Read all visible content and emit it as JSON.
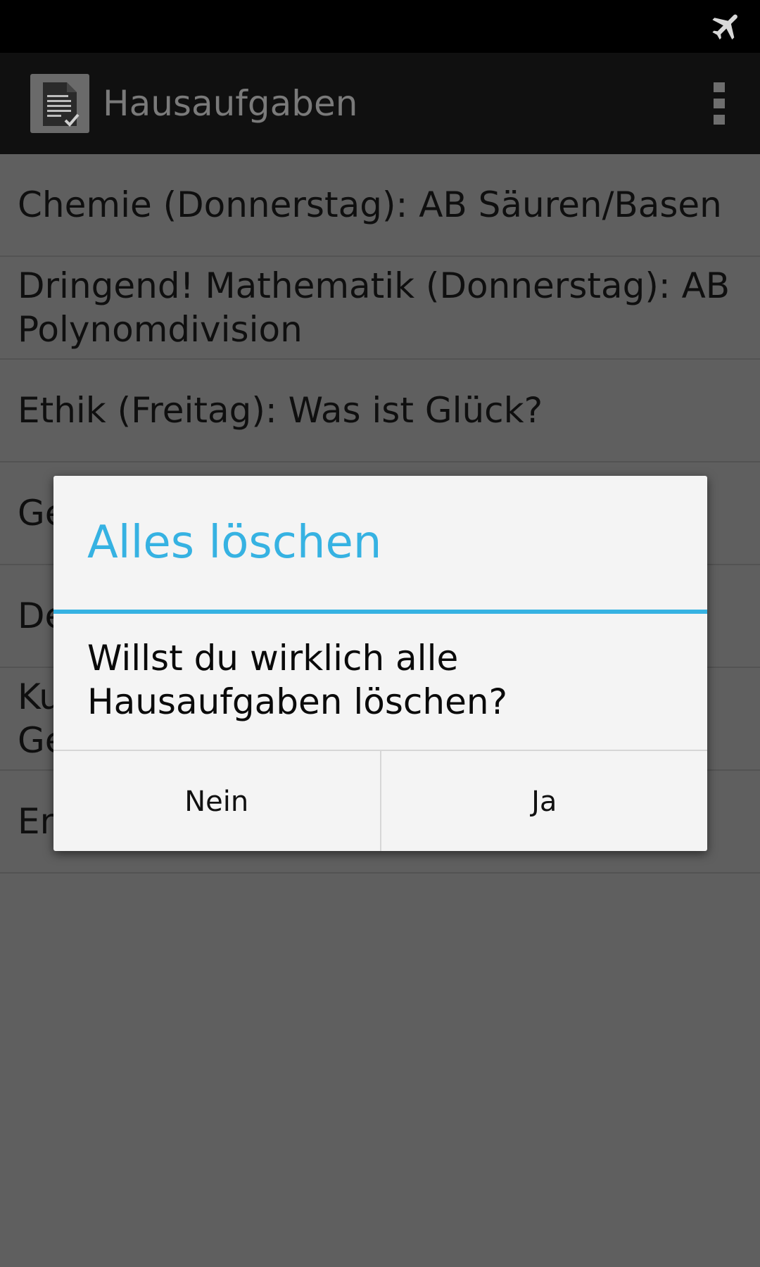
{
  "status_bar": {
    "icons": [
      "airplane-mode-icon"
    ]
  },
  "action_bar": {
    "app_icon": "homework-document-icon",
    "title": "Hausaufgaben",
    "overflow_icon": "overflow-menu-icon"
  },
  "homework_list": {
    "items": [
      {
        "lines": [
          "Chemie (Donnerstag): AB Säuren/Basen"
        ]
      },
      {
        "lines": [
          "Dringend! Mathematik (Donnerstag): AB",
          "Polynomdivision"
        ]
      },
      {
        "lines": [
          "Ethik (Freitag): Was ist Glück?"
        ]
      },
      {
        "lines": [
          "Ge"
        ]
      },
      {
        "lines": [
          "De"
        ]
      },
      {
        "lines": [
          "Ku",
          "Ge"
        ]
      },
      {
        "lines": [
          "En"
        ]
      }
    ]
  },
  "dialog": {
    "title": "Alles löschen",
    "message_lines": [
      "Willst du wirklich alle",
      "Hausaufgaben löschen?"
    ],
    "negative_label": "Nein",
    "positive_label": "Ja"
  },
  "colors": {
    "accent": "#36b2e2",
    "dim_background": "#5f5f5f",
    "action_bar": "#101010",
    "status_bar": "#000000",
    "dialog_background": "#f4f4f4"
  }
}
